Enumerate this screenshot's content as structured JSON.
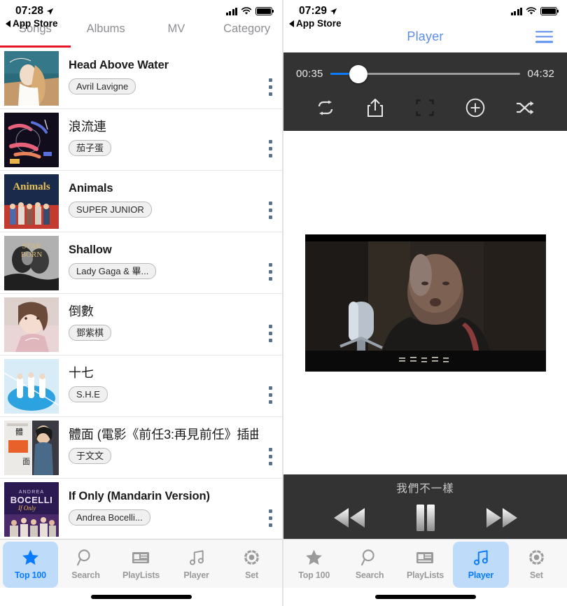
{
  "left": {
    "status": {
      "time": "07:28",
      "back_label": "App Store"
    },
    "tabs": [
      {
        "label": "Songs",
        "active": true
      },
      {
        "label": "Albums",
        "active": false
      },
      {
        "label": "MV",
        "active": false
      },
      {
        "label": "Category",
        "active": false
      }
    ],
    "accent_underline": "#e8142a",
    "songs": [
      {
        "title": "Head Above Water",
        "artist": "Avril Lavigne",
        "cjk": false,
        "cover": "avril"
      },
      {
        "title": "浪流連",
        "artist": "茄子蛋",
        "cjk": true,
        "cover": "langliulian"
      },
      {
        "title": "Animals",
        "artist": "SUPER JUNIOR",
        "cjk": false,
        "cover": "animals"
      },
      {
        "title": "Shallow",
        "artist": "Lady Gaga & 畢...",
        "cjk": false,
        "cover": "shallow"
      },
      {
        "title": "倒數",
        "artist": "鄧紫棋",
        "cjk": true,
        "cover": "daoshu"
      },
      {
        "title": "十七",
        "artist": "S.H.E",
        "cjk": true,
        "cover": "shiqi"
      },
      {
        "title": "體面 (電影《前任3:再見前任》插曲)",
        "artist": "于文文",
        "cjk": true,
        "cover": "timian"
      },
      {
        "title": "If Only (Mandarin Version)",
        "artist": "Andrea Bocelli...",
        "cjk": false,
        "cover": "bocelli"
      }
    ],
    "tabbar": [
      {
        "label": "Top 100",
        "icon": "star-icon",
        "active": true
      },
      {
        "label": "Search",
        "icon": "search-icon",
        "active": false
      },
      {
        "label": "PlayLists",
        "icon": "playlists-icon",
        "active": false
      },
      {
        "label": "Player",
        "icon": "music-note-icon",
        "active": false
      },
      {
        "label": "Set",
        "icon": "gear-icon",
        "active": false
      }
    ]
  },
  "right": {
    "status": {
      "time": "07:29",
      "back_label": "App Store"
    },
    "nav": {
      "title": "Player",
      "menu_icon": "hamburger-icon"
    },
    "player": {
      "elapsed": "00:35",
      "duration": "04:32",
      "progress_percent": 15,
      "progress_color": "#0a7bff",
      "controls": [
        {
          "name": "repeat-icon"
        },
        {
          "name": "share-icon"
        },
        {
          "name": "fullscreen-icon"
        },
        {
          "name": "add-icon"
        },
        {
          "name": "shuffle-icon"
        }
      ]
    },
    "now_playing": "我們不一樣",
    "video_caption": "這麼多年的兄弟",
    "transport": [
      {
        "name": "previous-button"
      },
      {
        "name": "pause-button"
      },
      {
        "name": "next-button"
      }
    ],
    "tabbar": [
      {
        "label": "Top 100",
        "icon": "star-icon",
        "active": false
      },
      {
        "label": "Search",
        "icon": "search-icon",
        "active": false
      },
      {
        "label": "PlayLists",
        "icon": "playlists-icon",
        "active": false
      },
      {
        "label": "Player",
        "icon": "music-note-icon",
        "active": true
      },
      {
        "label": "Set",
        "icon": "gear-icon",
        "active": false
      }
    ]
  }
}
